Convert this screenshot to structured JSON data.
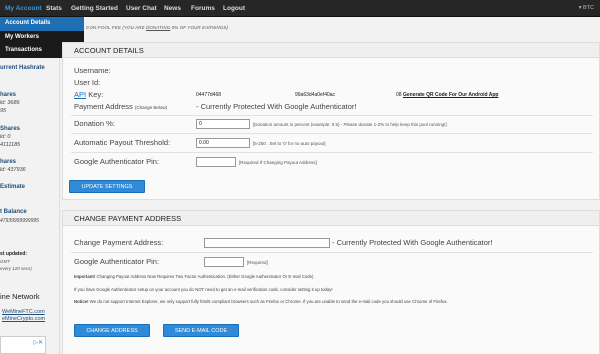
{
  "nav": {
    "items": [
      "My Account",
      "Stats",
      "Getting Started",
      "User Chat",
      "News",
      "Forums",
      "Logout"
    ],
    "btc": "BTC"
  },
  "dropdown": [
    "Account Details",
    "My Workers",
    "Transactions"
  ],
  "fee_line": {
    "prefix": "0.0% FOOL FEE (YOU ARE",
    "link": "DONATING",
    "suffix": "0% OF YOUR EARNINGS)"
  },
  "sidebar": {
    "current_hashrate": "urrent Hashrate",
    "shares_1": {
      "head": "hares",
      "line1": "ld: 3686",
      "line2": "95"
    },
    "shares_2": {
      "head": "Shares",
      "line1": "ld: 0",
      "line2": "4111185"
    },
    "shares_3": {
      "head": "hares",
      "line1": "ld: 437936"
    },
    "estimate": "Estimate",
    "balance": {
      "head": "t Balance",
      "value": "47939999999995"
    },
    "updated": {
      "head": "st updated:",
      "line1": "GMT",
      "line2": "every 120 secs)"
    },
    "network": {
      "head": "ine Network",
      "link1": "WeMineFTC.com",
      "link2": "eMineCrypto.com"
    }
  },
  "account_details": {
    "title": "ACCOUNT DETAILS",
    "username_label": "Username:",
    "userid_label": "User Id:",
    "api_link": "API",
    "key_label": "Key:",
    "key_value": "04477d468",
    "key_tail": "99a63d4a0ef40ac",
    "key_end": "08",
    "qr_link": "Generate QR Code For Our Android App",
    "payment_label": "Payment Address",
    "payment_small": "(Change Below)",
    "payment_value": "- Currently Protected With Google Authenticator!",
    "donation_label": "Donation %:",
    "donation_value": "0",
    "donation_hint": "[Donation amount in percent (example: 0.5) - Please donate 1-2% to help keep this pool running!]",
    "threshold_label": "Automatic Payout Threshold:",
    "threshold_value": "0.00",
    "threshold_hint": "[5-250 . Set to '0' for no auto payout]",
    "ga_label": "Google Authenticator Pin:",
    "ga_hint": "[Required If Changing Payout Address]",
    "update_button": "UPDATE SETTINGS"
  },
  "change_payment": {
    "title": "CHANGE PAYMENT ADDRESS",
    "address_label": "Change Payment Address:",
    "address_value": "- Currently Protected With Google Authenticator!",
    "ga_label": "Google Authenticator Pin:",
    "ga_hint": "[Required]",
    "notice1_bold": "Important!",
    "notice1": "Changing Payout Address Now Requires Two Factor Authentication. (Either Google Authenticator Or E-mail Code)",
    "notice2": "If you have Google Authenticator setup on your account you do NOT need to get an e-mail verification code, consider setting it up today!",
    "notice3_bold": "Notice!",
    "notice3": "We do not support Internet Explorer, we only support fully html5 compliant browsers such as Firefox or Chrome. If you are unable to send the e-mail code you should use Chrome of Firefox.",
    "change_button": "CHANGE ADDRESS",
    "email_button": "SEND E-MAIL CODE"
  }
}
